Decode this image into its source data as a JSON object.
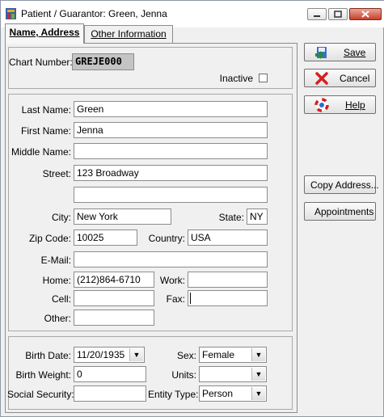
{
  "window": {
    "title": "Patient / Guarantor: Green, Jenna",
    "minimize": "minimize",
    "maximize": "maximize",
    "close": "close"
  },
  "tabs": [
    {
      "label": "Name, Address",
      "active": true
    },
    {
      "label": "Other Information",
      "active": false
    }
  ],
  "chart": {
    "label": "Chart Number:",
    "value": "GREJE000"
  },
  "inactive": {
    "label": "Inactive",
    "checked": false
  },
  "address": {
    "last_name": {
      "label": "Last Name:",
      "value": "Green"
    },
    "first_name": {
      "label": "First Name:",
      "value": "Jenna"
    },
    "middle_name": {
      "label": "Middle Name:",
      "value": ""
    },
    "street": {
      "label": "Street:",
      "value": "123 Broadway",
      "value2": ""
    },
    "city": {
      "label": "City:",
      "value": "New York"
    },
    "state": {
      "label": "State:",
      "value": "NY"
    },
    "zip": {
      "label": "Zip Code:",
      "value": "10025"
    },
    "country": {
      "label": "Country:",
      "value": "USA"
    },
    "email": {
      "label": "E-Mail:",
      "value": ""
    },
    "home": {
      "label": "Home:",
      "value": "(212)864-6710"
    },
    "work": {
      "label": "Work:",
      "value": ""
    },
    "cell": {
      "label": "Cell:",
      "value": ""
    },
    "fax": {
      "label": "Fax:",
      "value": ""
    },
    "other": {
      "label": "Other:",
      "value": ""
    }
  },
  "personal": {
    "birth_date": {
      "label": "Birth Date:",
      "value": "11/20/1935"
    },
    "sex": {
      "label": "Sex:",
      "value": "Female"
    },
    "birth_weight": {
      "label": "Birth Weight:",
      "value": "0"
    },
    "units": {
      "label": "Units:",
      "value": ""
    },
    "ssn": {
      "label": "Social Security:",
      "value": ""
    },
    "entity_type": {
      "label": "Entity Type:",
      "value": "Person"
    }
  },
  "buttons": {
    "save": "Save",
    "cancel": "Cancel",
    "help": "Help",
    "copy_address": "Copy Address...",
    "appointments": "Appointments"
  },
  "colors": {
    "readonly_field": "#c4c4c4",
    "save_icon": "#2b8a3e",
    "cancel_icon": "#d42020",
    "help_icon": "#2a6fd6"
  }
}
